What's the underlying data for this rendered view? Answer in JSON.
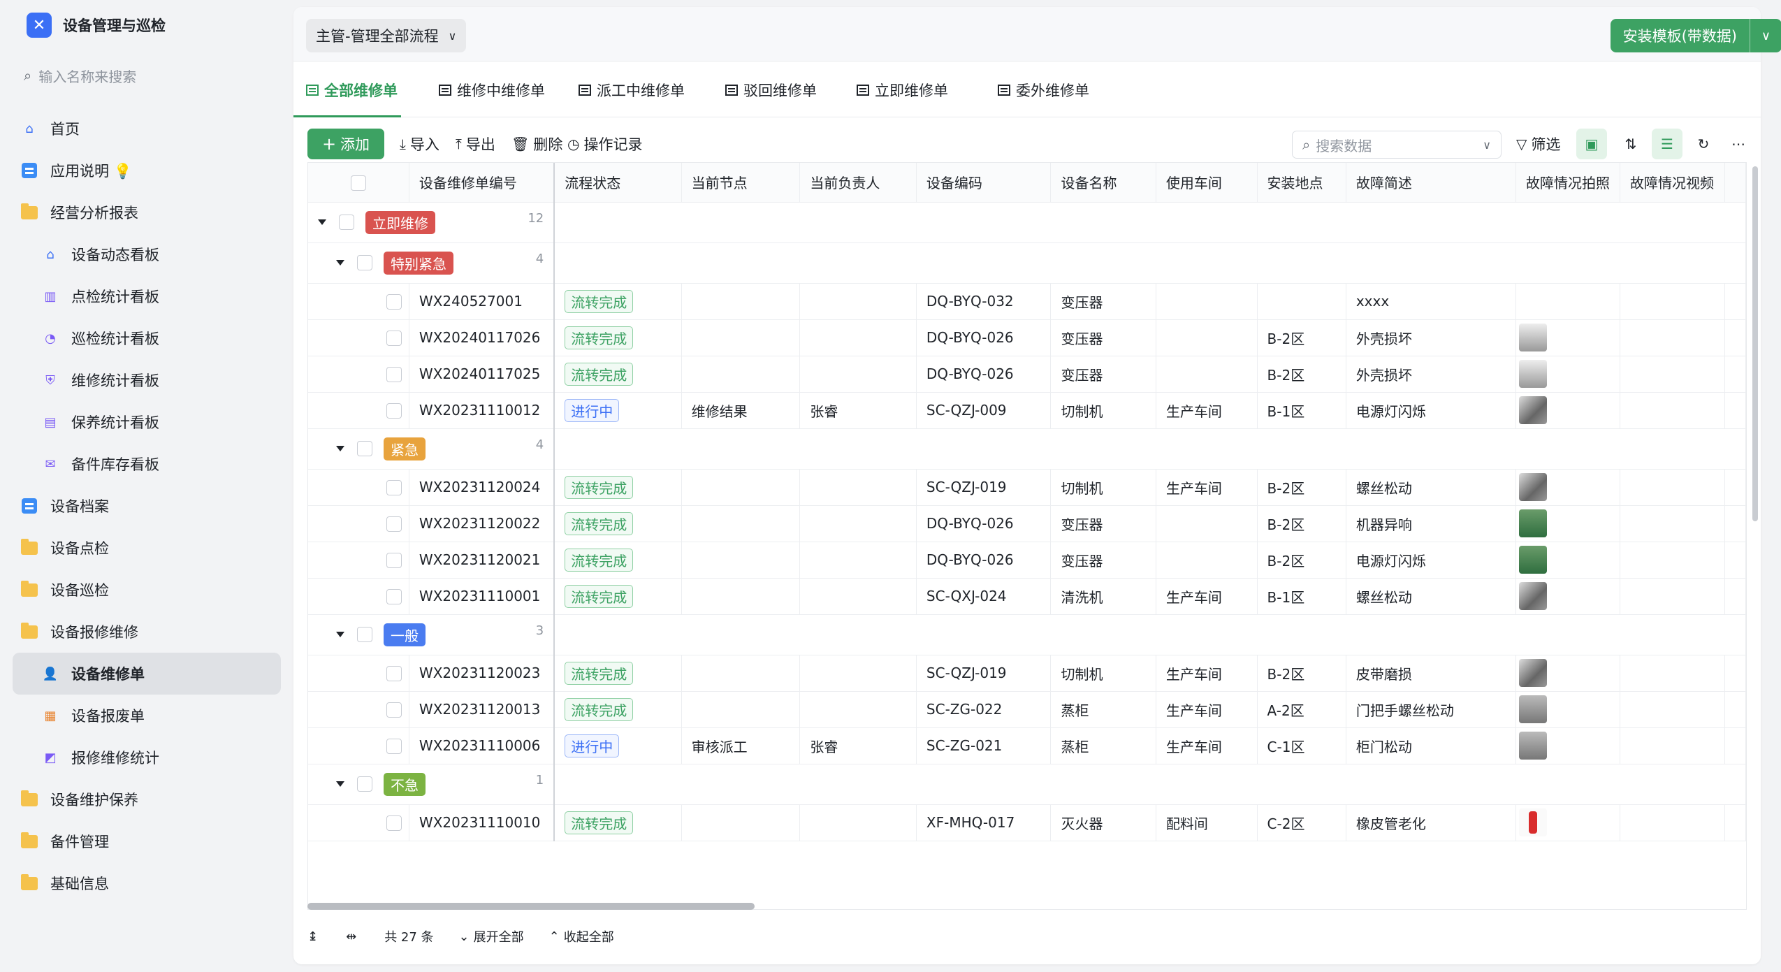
{
  "app": {
    "title": "设备管理与巡检",
    "logo": "tool-icon"
  },
  "sidebar": {
    "search_placeholder": "输入名称来搜索",
    "items": [
      {
        "label": "首页",
        "icon": "home-icon",
        "level": 0
      },
      {
        "label": "应用说明 💡",
        "icon": "doc-icon",
        "level": 0
      },
      {
        "label": "经营分析报表",
        "icon": "folder-icon",
        "level": 0
      },
      {
        "label": "设备动态看板",
        "icon": "home-icon",
        "level": 1
      },
      {
        "label": "点检统计看板",
        "icon": "bar-chart-icon",
        "level": 1
      },
      {
        "label": "巡检统计看板",
        "icon": "pie-chart-icon",
        "level": 1
      },
      {
        "label": "维修统计看板",
        "icon": "shield-icon",
        "level": 1
      },
      {
        "label": "保养统计看板",
        "icon": "calendar-icon",
        "level": 1
      },
      {
        "label": "备件库存看板",
        "icon": "inbox-icon",
        "level": 1
      },
      {
        "label": "设备档案",
        "icon": "doc-icon",
        "level": 0
      },
      {
        "label": "设备点检",
        "icon": "folder-icon",
        "level": 0
      },
      {
        "label": "设备巡检",
        "icon": "folder-icon",
        "level": 0
      },
      {
        "label": "设备报修维修",
        "icon": "folder-icon",
        "level": 0
      },
      {
        "label": "设备维修单",
        "icon": "user-icon",
        "level": 1,
        "active": true
      },
      {
        "label": "设备报废单",
        "icon": "report-icon",
        "level": 1
      },
      {
        "label": "报修维修统计",
        "icon": "chart-icon",
        "level": 1
      },
      {
        "label": "设备维护保养",
        "icon": "folder-icon",
        "level": 0
      },
      {
        "label": "备件管理",
        "icon": "folder-icon",
        "level": 0
      },
      {
        "label": "基础信息",
        "icon": "folder-icon",
        "level": 0
      }
    ]
  },
  "header": {
    "view_select": "主管-管理全部流程",
    "install_button": "安装模板(带数据)"
  },
  "tabs": [
    "全部维修单",
    "维修中维修单",
    "派工中维修单",
    "驳回维修单",
    "立即维修单",
    "委外维修单"
  ],
  "toolbar": {
    "add": "添加",
    "import": "导入",
    "export": "导出",
    "delete": "删除",
    "log": "操作记录",
    "search_placeholder": "搜索数据",
    "filter": "筛选"
  },
  "columns": [
    "设备维修单编号",
    "流程状态",
    "当前节点",
    "当前负责人",
    "设备编码",
    "设备名称",
    "使用车间",
    "安装地点",
    "故障简述",
    "故障情况拍照",
    "故障情况视频"
  ],
  "groups": [
    {
      "tag": "立即维修",
      "count": "12",
      "color": "#d9534f",
      "level": 0,
      "rows": []
    },
    {
      "tag": "特别紧急",
      "count": "4",
      "color": "#d9534f",
      "level": 1,
      "rows": [
        {
          "id": "WX240527001",
          "status": "流转完成",
          "s": "done",
          "node": "",
          "owner": "",
          "code": "DQ-BYQ-032",
          "name": "变压器",
          "shop": "",
          "loc": "",
          "fault": "xxxx",
          "img": ""
        },
        {
          "id": "WX20240117026",
          "status": "流转完成",
          "s": "done",
          "node": "",
          "owner": "",
          "code": "DQ-BYQ-026",
          "name": "变压器",
          "shop": "",
          "loc": "B-2区",
          "fault": "外壳损坏",
          "img": "th-light"
        },
        {
          "id": "WX20240117025",
          "status": "流转完成",
          "s": "done",
          "node": "",
          "owner": "",
          "code": "DQ-BYQ-026",
          "name": "变压器",
          "shop": "",
          "loc": "B-2区",
          "fault": "外壳损坏",
          "img": "th-light"
        },
        {
          "id": "WX20231110012",
          "status": "进行中",
          "s": "prog",
          "node": "维修结果",
          "owner": "张睿",
          "code": "SC-QZJ-009",
          "name": "切制机",
          "shop": "生产车间",
          "loc": "B-1区",
          "fault": "电源灯闪烁",
          "img": "th-metal"
        }
      ]
    },
    {
      "tag": "紧急",
      "count": "4",
      "color": "#e8a33d",
      "level": 1,
      "rows": [
        {
          "id": "WX20231120024",
          "status": "流转完成",
          "s": "done",
          "node": "",
          "owner": "",
          "code": "SC-QZJ-019",
          "name": "切制机",
          "shop": "生产车间",
          "loc": "B-2区",
          "fault": "螺丝松动",
          "img": "th-metal"
        },
        {
          "id": "WX20231120022",
          "status": "流转完成",
          "s": "done",
          "node": "",
          "owner": "",
          "code": "DQ-BYQ-026",
          "name": "变压器",
          "shop": "",
          "loc": "B-2区",
          "fault": "机器异响",
          "img": "th-green"
        },
        {
          "id": "WX20231120021",
          "status": "流转完成",
          "s": "done",
          "node": "",
          "owner": "",
          "code": "DQ-BYQ-026",
          "name": "变压器",
          "shop": "",
          "loc": "B-2区",
          "fault": "电源灯闪烁",
          "img": "th-green"
        },
        {
          "id": "WX20231110001",
          "status": "流转完成",
          "s": "done",
          "node": "",
          "owner": "",
          "code": "SC-QXJ-024",
          "name": "清洗机",
          "shop": "生产车间",
          "loc": "B-1区",
          "fault": "螺丝松动",
          "img": "th-metal"
        }
      ]
    },
    {
      "tag": "一般",
      "count": "3",
      "color": "#4a7cf0",
      "level": 1,
      "rows": [
        {
          "id": "WX20231120023",
          "status": "流转完成",
          "s": "done",
          "node": "",
          "owner": "",
          "code": "SC-QZJ-019",
          "name": "切制机",
          "shop": "生产车间",
          "loc": "B-2区",
          "fault": "皮带磨损",
          "img": "th-metal"
        },
        {
          "id": "WX20231120013",
          "status": "流转完成",
          "s": "done",
          "node": "",
          "owner": "",
          "code": "SC-ZG-022",
          "name": "蒸柜",
          "shop": "生产车间",
          "loc": "A-2区",
          "fault": "门把手螺丝松动",
          "img": "th-gray"
        },
        {
          "id": "WX20231110006",
          "status": "进行中",
          "s": "prog",
          "node": "审核派工",
          "owner": "张睿",
          "code": "SC-ZG-021",
          "name": "蒸柜",
          "shop": "生产车间",
          "loc": "C-1区",
          "fault": "柜门松动",
          "img": "th-gray"
        }
      ]
    },
    {
      "tag": "不急",
      "count": "1",
      "color": "#7cb342",
      "level": 1,
      "rows": [
        {
          "id": "WX20231110010",
          "status": "流转完成",
          "s": "done",
          "node": "",
          "owner": "",
          "code": "XF-MHQ-017",
          "name": "灭火器",
          "shop": "配料间",
          "loc": "C-2区",
          "fault": "橡皮管老化",
          "img": "th-red"
        }
      ]
    }
  ],
  "footer": {
    "total": "共 27 条",
    "expand": "展开全部",
    "collapse": "收起全部"
  }
}
